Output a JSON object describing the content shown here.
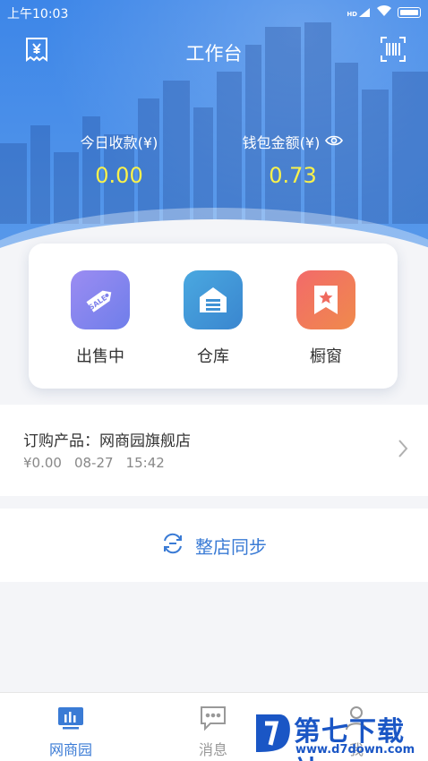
{
  "status_bar": {
    "time": "上午10:03",
    "network": "HD"
  },
  "header": {
    "title": "工作台",
    "left_icon": "receipt-yen-icon",
    "right_icon": "barcode-scan-icon"
  },
  "summary": {
    "today_label": "今日收款(¥)",
    "today_value": "0.00",
    "wallet_label": "钱包金额(¥)",
    "wallet_value": "0.73",
    "wallet_icon": "eye-icon",
    "value_color": "#f9f24b"
  },
  "quick_actions": [
    {
      "label": "出售中",
      "icon": "sale-tag-icon"
    },
    {
      "label": "仓库",
      "icon": "warehouse-icon"
    },
    {
      "label": "橱窗",
      "icon": "showcase-bookmark-icon"
    }
  ],
  "order": {
    "title": "订购产品：网商园旗舰店",
    "amount": "¥0.00",
    "date": "08-27",
    "time": "15:42"
  },
  "sync": {
    "label": "整店同步",
    "icon": "sync-icon"
  },
  "tabs": [
    {
      "label": "网商园",
      "icon": "chart-icon",
      "active": true
    },
    {
      "label": "消息",
      "icon": "message-icon",
      "active": false
    },
    {
      "label": "我",
      "icon": "user-icon",
      "active": false
    }
  ],
  "watermark": {
    "main": "第七下载站",
    "sub": "www.d7down.com"
  },
  "colors": {
    "primary": "#3a7bd5",
    "header": "#4a8fe9"
  }
}
